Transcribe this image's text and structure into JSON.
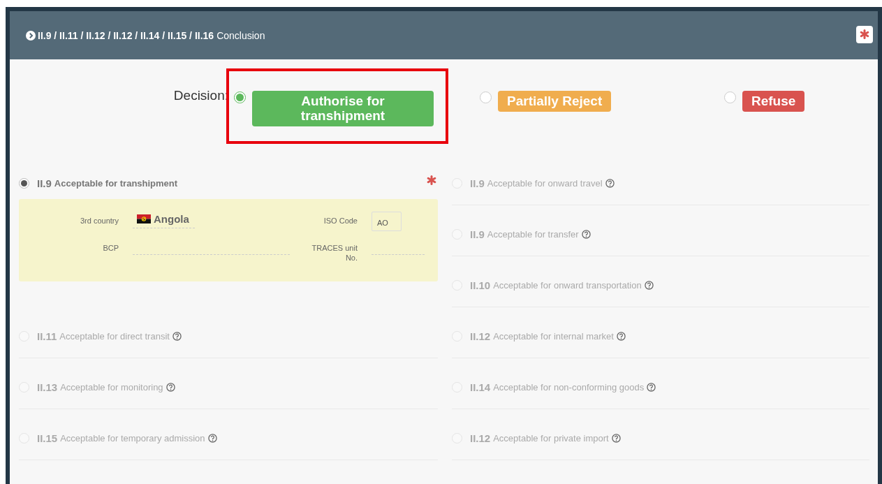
{
  "header": {
    "codes": "II.9 / II.11 / II.12 / II.12 / II.14 / II.15 / II.16",
    "title": "Conclusion",
    "required": true
  },
  "decision": {
    "label": "Decision:",
    "options": [
      {
        "label": "Authorise for transhipment",
        "kind": "authorise",
        "selected": true,
        "highlighted": true
      },
      {
        "label": "Partially Reject",
        "kind": "partial",
        "selected": false,
        "highlighted": false
      },
      {
        "label": "Refuse",
        "kind": "refuse",
        "selected": false,
        "highlighted": false
      }
    ]
  },
  "left_options": [
    {
      "code": "II.9",
      "label": "Acceptable for transhipment",
      "selected": true,
      "disabled": false,
      "help": false,
      "required": true,
      "details": [
        {
          "label": "3rd country",
          "kind": "country",
          "value": "Angola"
        },
        {
          "label": "ISO Code",
          "kind": "code_box",
          "value": "AO"
        },
        {
          "label": "BCP",
          "kind": "blank"
        },
        {
          "label": "TRACES unit No.",
          "kind": "blank"
        }
      ]
    },
    {
      "code": "II.11",
      "label": "Acceptable for direct transit",
      "selected": false,
      "disabled": true,
      "help": true,
      "required": false
    },
    {
      "code": "II.13",
      "label": "Acceptable for monitoring",
      "selected": false,
      "disabled": true,
      "help": true,
      "required": false
    },
    {
      "code": "II.15",
      "label": "Acceptable for temporary admission",
      "selected": false,
      "disabled": true,
      "help": true,
      "required": false
    }
  ],
  "right_options": [
    {
      "code": "II.9",
      "label": "Acceptable for onward travel",
      "selected": false,
      "disabled": true,
      "help": true,
      "required": false
    },
    {
      "code": "II.9",
      "label": "Acceptable for transfer",
      "selected": false,
      "disabled": true,
      "help": true,
      "required": false
    },
    {
      "code": "II.10",
      "label": "Acceptable for onward transportation",
      "selected": false,
      "disabled": true,
      "help": true,
      "required": false
    },
    {
      "code": "II.12",
      "label": "Acceptable for internal market",
      "selected": false,
      "disabled": true,
      "help": true,
      "required": false
    },
    {
      "code": "II.14",
      "label": "Acceptable for non-conforming goods",
      "selected": false,
      "disabled": true,
      "help": true,
      "required": false
    },
    {
      "code": "II.12",
      "label": "Acceptable for private import",
      "selected": false,
      "disabled": true,
      "help": true,
      "required": false
    }
  ]
}
